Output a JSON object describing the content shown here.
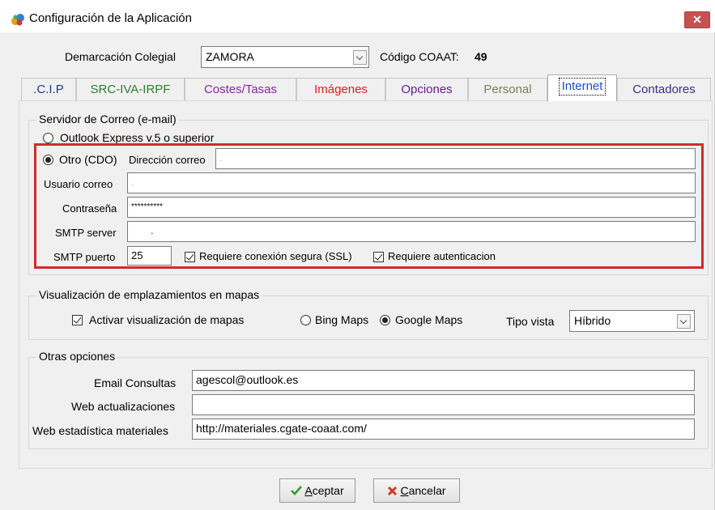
{
  "window": {
    "title": "Configuración de la Aplicación",
    "close_glyph": "✕"
  },
  "header": {
    "demarcacion_label": "Demarcación Colegial",
    "demarcacion_value": "ZAMORA",
    "codigo_label": "Código COAAT:",
    "codigo_value": "49"
  },
  "tabs": [
    {
      "label": ".C.I.P",
      "color": "#1f3a93"
    },
    {
      "label": "SRC-IVA-IRPF",
      "color": "#2e7d32"
    },
    {
      "label": "Costes/Tasas",
      "color": "#8e24aa"
    },
    {
      "label": "Imágenes",
      "color": "#e02020"
    },
    {
      "label": "Opciones",
      "color": "#6a1b9a"
    },
    {
      "label": "Personal",
      "color": "#7d7d5f"
    },
    {
      "label": "Internet",
      "color": "#1a4fd6"
    },
    {
      "label": "Contadores",
      "color": "#3b2f8f"
    }
  ],
  "mail": {
    "group_title": "Servidor de Correo (e-mail)",
    "outlook_label": "Outlook Express v.5 o superior",
    "otro_label": "Otro (CDO)",
    "direccion_label": "Dirección correo",
    "direccion_value": ".",
    "usuario_label": "Usuario correo",
    "usuario_value": ".",
    "password_label": "Contraseña",
    "password_value": "**********",
    "smtp_label": "SMTP server",
    "smtp_value": ".",
    "puerto_label": "SMTP puerto",
    "puerto_value": "25",
    "ssl_label": "Requiere conexión segura (SSL)",
    "auth_label": "Requiere autenticacion"
  },
  "maps": {
    "group_title": "Visualización de emplazamientos en mapas",
    "activar_label": "Activar visualización de mapas",
    "bing_label": "Bing Maps",
    "google_label": "Google Maps",
    "tipo_label": "Tipo vista",
    "tipo_value": "Híbrido"
  },
  "otras": {
    "group_title": "Otras opciones",
    "email_label": "Email Consultas",
    "email_value": "agescol@outlook.es",
    "web_act_label": "Web actualizaciones",
    "web_act_value": "",
    "web_est_label": "Web estadística materiales",
    "web_est_value": "http://materiales.cgate-coaat.com/"
  },
  "buttons": {
    "aceptar_first": "A",
    "aceptar_rest": "ceptar",
    "cancelar_first": "C",
    "cancelar_rest": "ancelar"
  },
  "colors": {
    "highlight_border": "#d32a2a",
    "ok_check": "#2e9e2e",
    "cancel_x": "#d9361e"
  }
}
